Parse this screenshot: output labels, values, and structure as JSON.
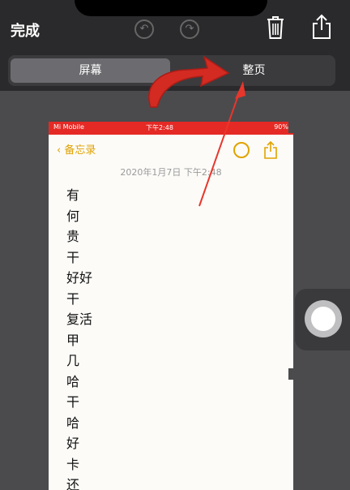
{
  "toolbar": {
    "done_label": "完成",
    "undo_icon": "undo-icon",
    "redo_icon": "redo-icon",
    "trash_icon": "trash-icon",
    "share_icon": "share-icon"
  },
  "segmented": {
    "left_label": "屏幕",
    "right_label": "整页",
    "selected": "屏幕"
  },
  "preview": {
    "status": {
      "carrier": "Mi Mobile",
      "time": "下午2:48",
      "battery": "90%"
    },
    "back_label": "备忘录",
    "date": "2020年1月7日 下午2:48",
    "lines": [
      "有",
      "何",
      "贵",
      "干",
      "好好",
      "干",
      "复活",
      "甲",
      "几",
      "哈",
      "干",
      "哈",
      "好",
      "卡",
      "还"
    ]
  },
  "colors": {
    "accent": "#e0a300",
    "status_red": "#e52a25",
    "annotation_red": "#e8362c"
  }
}
